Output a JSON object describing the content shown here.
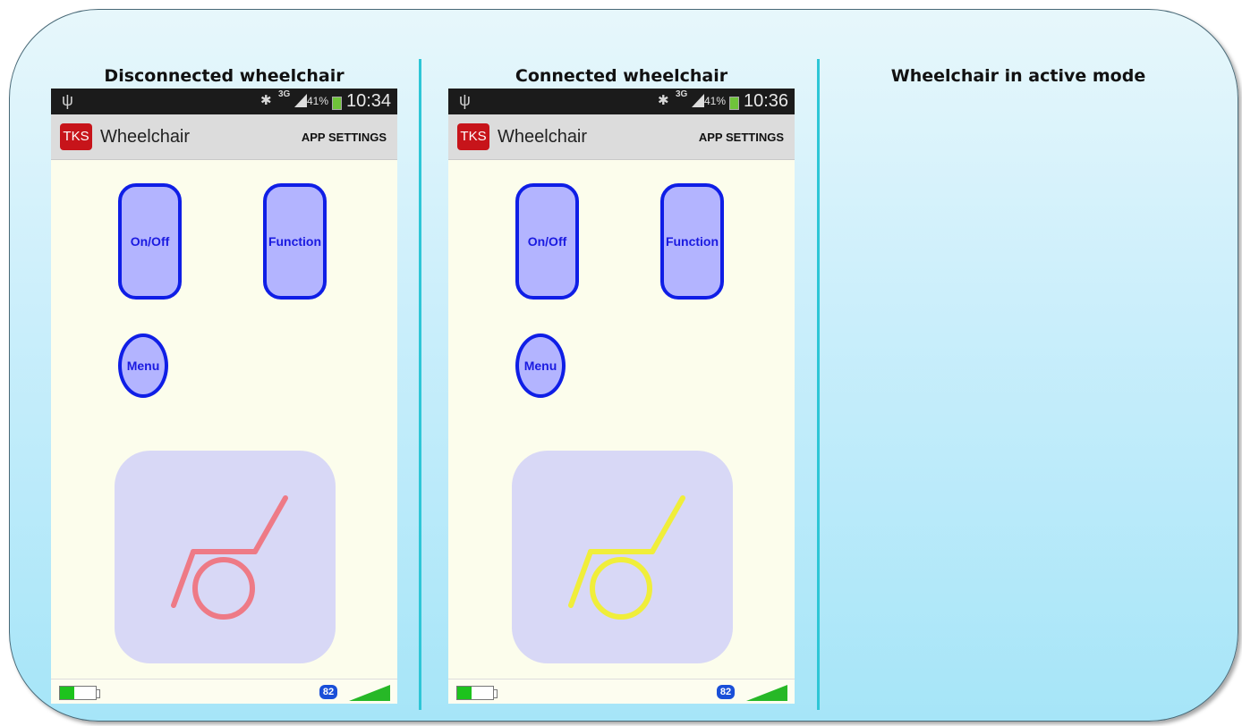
{
  "columns": [
    {
      "title": "Disconnected wheelchair"
    },
    {
      "title": "Connected wheelchair"
    },
    {
      "title": "Wheelchair in active mode"
    }
  ],
  "phones": [
    {
      "status": {
        "time": "10:34",
        "battery_pct": "41%",
        "network": "3G",
        "usb_icon": "usb-icon",
        "bluetooth_icon": "bluetooth-icon"
      },
      "actionbar": {
        "logo": "TKS",
        "title": "Wheelchair",
        "settings": "APP SETTINGS"
      },
      "buttons": {
        "onoff": "On/Off",
        "function": "Function",
        "menu": "Menu"
      },
      "wheelchair_color": "#ee7a86",
      "bottom": {
        "battery_level": 0.4,
        "bt_label": "82",
        "signal_bars": 5
      }
    },
    {
      "status": {
        "time": "10:36",
        "battery_pct": "41%",
        "network": "3G",
        "usb_icon": "usb-icon",
        "bluetooth_icon": "bluetooth-icon"
      },
      "actionbar": {
        "logo": "TKS",
        "title": "Wheelchair",
        "settings": "APP SETTINGS"
      },
      "buttons": {
        "onoff": "On/Off",
        "function": "Function",
        "menu": "Menu"
      },
      "wheelchair_color": "#f0ee3a",
      "bottom": {
        "battery_level": 0.4,
        "bt_label": "82",
        "signal_bars": 5
      }
    }
  ],
  "colors": {
    "panel_border": "#4a6a78",
    "divider": "#2ec6d6",
    "button_border": "#0f1ee6",
    "button_fill": "#b3b4ff"
  }
}
